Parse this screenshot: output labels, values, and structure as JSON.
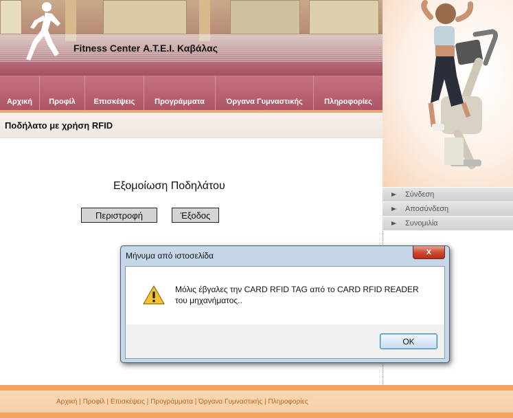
{
  "header": {
    "site_title": "Fitness Center Α.Τ.Ε.Ι. Καβάλας"
  },
  "nav": {
    "items": [
      "Αρχική",
      "Προφίλ",
      "Επισκέψεις",
      "Προγράμματα",
      "Όργανα Γυμναστικής",
      "Πληροφορίες"
    ]
  },
  "page": {
    "heading": "Ποδήλατο με χρήση RFID"
  },
  "sidebar": {
    "items": [
      "Σύνδεση",
      "Αποσύνδεση",
      "Συνομιλία"
    ]
  },
  "main": {
    "sim_title": "Εξομοίωση Ποδηλάτου",
    "rotate_button": "Περιστροφή",
    "exit_button": "Έξοδος"
  },
  "dialog": {
    "title": "Μήνυμα από ιστοσελίδα",
    "close_label": "x",
    "message": "Μόλις έβγαλες την CARD RFID TAG από το CARD RFID READER του μηχανήματος..",
    "ok_label": "OK",
    "icon": "warning-icon"
  },
  "footer": {
    "links": [
      "Αρχική",
      "Προφίλ",
      "Επισκέψεις",
      "Προγράμματα",
      "Όργανα Γυμναστικής",
      "Πληροφορίες"
    ],
    "separator": "|"
  },
  "colors": {
    "nav_bg": "#b9606e",
    "footer_bg": "#f8d8b6",
    "footer_link": "#b56a1e",
    "dialog_frame": "#c7d7ea"
  }
}
